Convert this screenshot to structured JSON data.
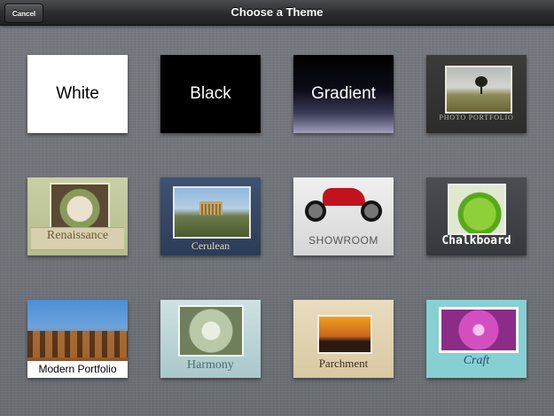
{
  "header": {
    "title": "Choose a Theme",
    "cancel_label": "Cancel"
  },
  "themes": [
    {
      "name": "White"
    },
    {
      "name": "Black"
    },
    {
      "name": "Gradient"
    },
    {
      "name": "PHOTO PORTFOLIO"
    },
    {
      "name": "Renaissance"
    },
    {
      "name": "Cerulean"
    },
    {
      "name": "SHOWROOM"
    },
    {
      "name": "Chalkboard"
    },
    {
      "name": "Modern Portfolio"
    },
    {
      "name": "Harmony"
    },
    {
      "name": "Parchment"
    },
    {
      "name": "Craft"
    }
  ]
}
